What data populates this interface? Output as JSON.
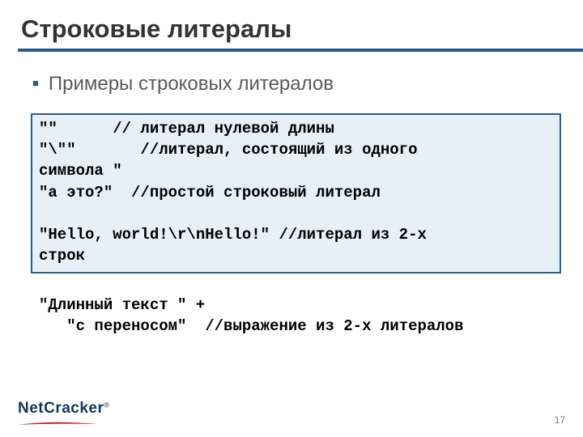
{
  "title": "Строковые литералы",
  "bullet": "Примеры строковых литералов",
  "code_box": "\"\"      // литерал нулевой длины\n\"\\\"\"       //литерал, состоящий из одного\nсимвола \"\n\"а это?\"  //простой строковый литерал\n\n\"Hello, world!\\r\\nHello!\" //литерал из 2-х\nстрок",
  "code_below": "\n\"Длинный текст \" +\n   \"с переносом\"  //выражение из 2-х литералов",
  "logo": {
    "text": "NetCracker",
    "reg": "®"
  },
  "page_number": "17"
}
